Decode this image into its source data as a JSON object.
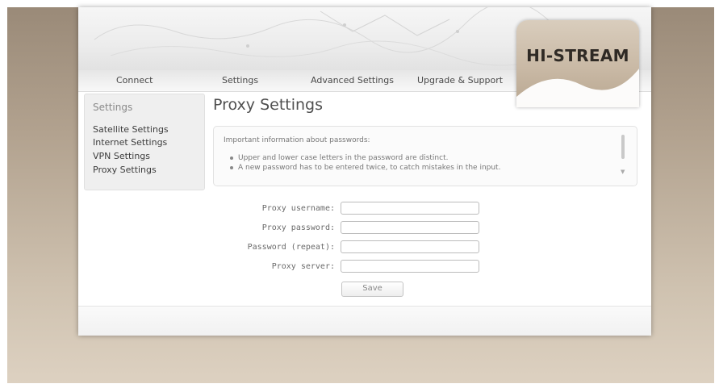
{
  "brand": {
    "logo": "HI-STREAM"
  },
  "nav": {
    "items": [
      {
        "label": "Connect"
      },
      {
        "label": "Settings"
      },
      {
        "label": "Advanced Settings"
      },
      {
        "label": "Upgrade & Support"
      }
    ]
  },
  "sidebar": {
    "title": "Settings",
    "items": [
      {
        "label": "Satellite Settings"
      },
      {
        "label": "Internet Settings"
      },
      {
        "label": "VPN Settings"
      },
      {
        "label": "Proxy Settings"
      }
    ]
  },
  "page": {
    "title": "Proxy Settings"
  },
  "info": {
    "heading": "Important information about passwords:",
    "bullets": [
      "Upper and lower case letters in the password are distinct.",
      "A new password has to be entered twice, to catch mistakes in the input."
    ]
  },
  "form": {
    "username_label": "Proxy username:",
    "username_value": "",
    "password_label": "Proxy password:",
    "password_value": "",
    "repeat_label": "Password (repeat):",
    "repeat_value": "",
    "server_label": "Proxy server:",
    "server_value": "",
    "save_label": "Save"
  },
  "colors": {
    "background": "#b3a390",
    "logo_tab": "#c9b9a5",
    "text": "#4a4a4a"
  }
}
